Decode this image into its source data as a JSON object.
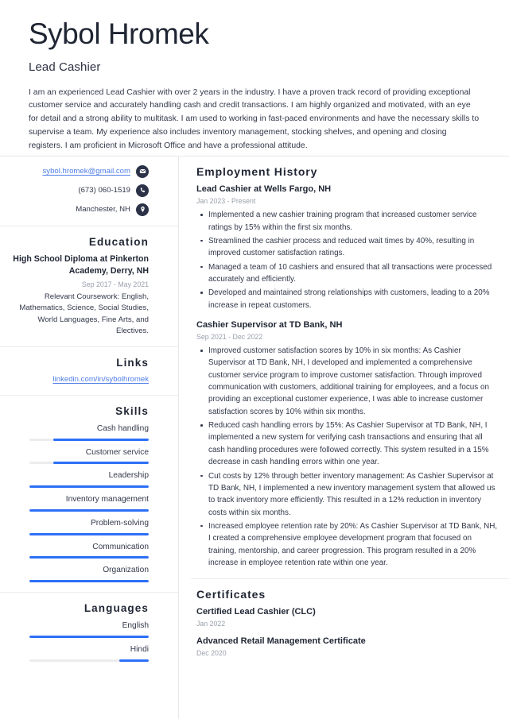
{
  "header": {
    "name": "Sybol Hromek",
    "job_title": "Lead Cashier",
    "summary": "I am an experienced Lead Cashier with over 2 years in the industry. I have a proven track record of providing exceptional customer service and accurately handling cash and credit transactions. I am highly organized and motivated, with an eye for detail and a strong ability to multitask. I am used to working in fast-paced environments and have the necessary skills to supervise a team. My experience also includes inventory management, stocking shelves, and opening and closing registers. I am proficient in Microsoft Office and have a professional attitude."
  },
  "contact": {
    "email": "sybol.hromek@gmail.com",
    "phone": "(673) 060-1519",
    "location": "Manchester, NH",
    "email_icon": "envelope-icon",
    "phone_icon": "phone-icon",
    "location_icon": "location-pin-icon"
  },
  "education": {
    "heading": "Education",
    "degree": "High School Diploma at Pinkerton Academy, Derry, NH",
    "date": "Sep 2017 - May 2021",
    "description": "Relevant Coursework: English, Mathematics, Science, Social Studies, World Languages, Fine Arts, and Electives."
  },
  "links": {
    "heading": "Links",
    "items": [
      {
        "label": "linkedin.com/in/sybolhromek"
      }
    ]
  },
  "skills": {
    "heading": "Skills",
    "items": [
      {
        "label": "Cash handling",
        "level": 80
      },
      {
        "label": "Customer service",
        "level": 80
      },
      {
        "label": "Leadership",
        "level": 100
      },
      {
        "label": "Inventory management",
        "level": 100
      },
      {
        "label": "Problem-solving",
        "level": 100
      },
      {
        "label": "Communication",
        "level": 100
      },
      {
        "label": "Organization",
        "level": 100
      }
    ]
  },
  "languages": {
    "heading": "Languages",
    "items": [
      {
        "label": "English",
        "level": 100
      },
      {
        "label": "Hindi",
        "level": 25
      }
    ]
  },
  "employment": {
    "heading": "Employment History",
    "jobs": [
      {
        "title": "Lead Cashier at Wells Fargo, NH",
        "date": "Jan 2023 - Present",
        "bullets": [
          "Implemented a new cashier training program that increased customer service ratings by 15% within the first six months.",
          "Streamlined the cashier process and reduced wait times by 40%, resulting in improved customer satisfaction ratings.",
          "Managed a team of 10 cashiers and ensured that all transactions were processed accurately and efficiently.",
          "Developed and maintained strong relationships with customers, leading to a 20% increase in repeat customers."
        ]
      },
      {
        "title": "Cashier Supervisor at TD Bank, NH",
        "date": "Sep 2021 - Dec 2022",
        "bullets": [
          "Improved customer satisfaction scores by 10% in six months: As Cashier Supervisor at TD Bank, NH, I developed and implemented a comprehensive customer service program to improve customer satisfaction. Through improved communication with customers, additional training for employees, and a focus on providing an exceptional customer experience, I was able to increase customer satisfaction scores by 10% within six months.",
          "Reduced cash handling errors by 15%: As Cashier Supervisor at TD Bank, NH, I implemented a new system for verifying cash transactions and ensuring that all cash handling procedures were followed correctly. This system resulted in a 15% decrease in cash handling errors within one year.",
          "Cut costs by 12% through better inventory management: As Cashier Supervisor at TD Bank, NH, I implemented a new inventory management system that allowed us to track inventory more efficiently. This resulted in a 12% reduction in inventory costs within six months.",
          "Increased employee retention rate by 20%: As Cashier Supervisor at TD Bank, NH, I created a comprehensive employee development program that focused on training, mentorship, and career progression. This program resulted in a 20% increase in employee retention rate within one year."
        ]
      }
    ]
  },
  "certificates": {
    "heading": "Certificates",
    "items": [
      {
        "name": "Certified Lead Cashier (CLC)",
        "date": "Jan 2022"
      },
      {
        "name": "Advanced Retail Management Certificate",
        "date": "Dec 2020"
      }
    ]
  },
  "colors": {
    "accent_blue": "#2d6ff7",
    "link_blue": "#4f7ee8",
    "ink": "#1f2533",
    "body_text": "#32384a",
    "muted": "#9aa0ac",
    "icon_circle": "#2b3247",
    "rule": "#e6e8ec",
    "bar_track": "#ececee"
  }
}
